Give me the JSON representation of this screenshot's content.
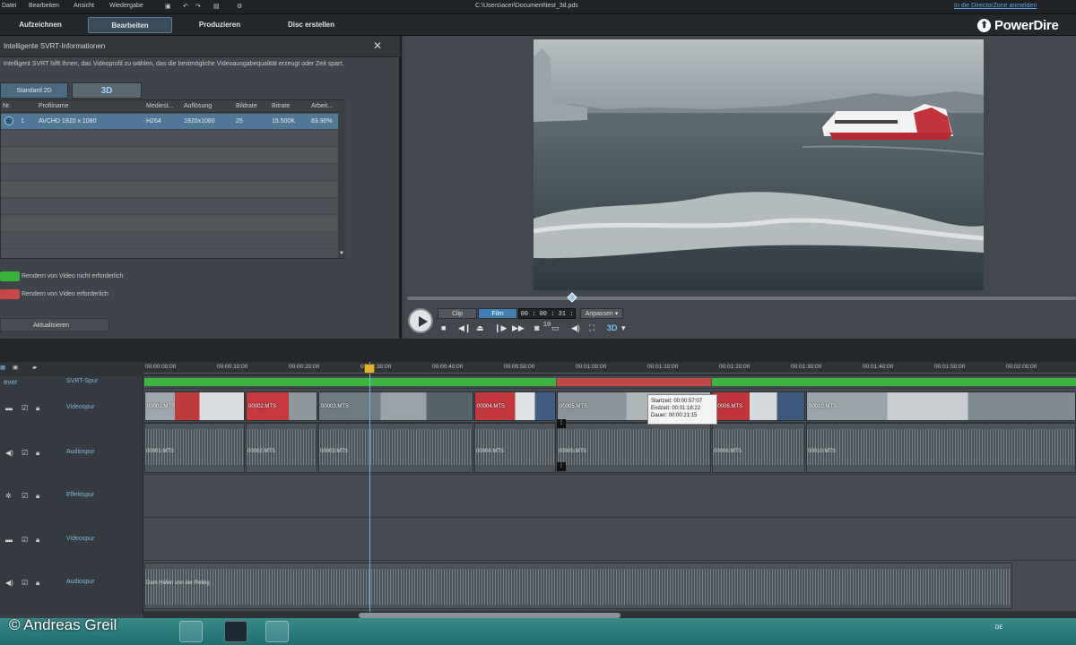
{
  "menu": {
    "items": [
      "Datei",
      "Bearbeiten",
      "Ansicht",
      "Wiedergabe"
    ],
    "file_path": "C:\\Users\\acer\\Document\\test_3d.pds",
    "login_link": "In die DirectorZone anmelden"
  },
  "tabs": {
    "capture": "Aufzeichnen",
    "edit": "Bearbeiten",
    "produce": "Produzieren",
    "disc": "Disc erstellen"
  },
  "app": {
    "logo": "PowerDire"
  },
  "svrt_panel": {
    "title": "Intelligente SVRT-Informationen",
    "description": "Intelligent SVRT hilft Ihnen, das Videoprofil zu wählen, das die bestmögliche Videoausgabequalität erzeugt oder Zeit spart.",
    "subtabs": [
      "Standard 2D",
      "3D"
    ],
    "columns": [
      "Nr.",
      "Profilname",
      "Mediest...",
      "Auflösung",
      "Bildrate",
      "Bitrate",
      "Arbeit..."
    ],
    "rows": [
      {
        "nr": "1",
        "profile": "AVCHD 1920 x 1080",
        "media": "H264",
        "resolution": "1920x1080",
        "framerate": "25",
        "bitrate": "15.500K",
        "work": "83.90%"
      }
    ],
    "legend": [
      {
        "text": "Rendern von Video nicht erforderlich",
        "color": "#36b23b"
      },
      {
        "text": "Rendern von Video erforderlich",
        "color": "#c84848"
      }
    ],
    "refresh_button": "Aktualisieren"
  },
  "preview": {
    "mode_clip": "Clip",
    "mode_film": "Film",
    "timecode": "00 : 00 : 31 : 10",
    "fit": "Anpassen",
    "three_d": "3D"
  },
  "timeline": {
    "ruler": [
      "00:00:00:00",
      "00:00:10:00",
      "00:00:20:00",
      "00:00:30:00",
      "00:00:40:00",
      "00:00:50:00",
      "00:01:00:00",
      "00:01:10:00",
      "00:01:20:00",
      "00:01:30:00",
      "00:01:40:00",
      "00:01:50:00",
      "00:02:00:00"
    ],
    "tracks": [
      {
        "name": "SVRT-Spur",
        "label_left": "ever"
      },
      {
        "name": "Videospur"
      },
      {
        "name": "Audiospur"
      },
      {
        "name": "Effektspur"
      },
      {
        "name": "Videospur"
      },
      {
        "name": "Audiospur"
      }
    ],
    "video_clips": [
      "00001.MTS",
      "00002.MTS",
      "00003.MTS",
      "00004.MTS",
      "00005.MTS",
      "00006.MTS",
      "00010.MTS"
    ],
    "audio_clips": [
      "00001.MTS",
      "00002.MTS",
      "00003.MTS",
      "00004.MTS",
      "00005.MTS",
      "00006.MTS",
      "00010.MTS"
    ],
    "music_clip": "Dam Hafen von der Reling",
    "tooltip": {
      "start": "Startzeit: 00:00:57:07",
      "end": "Endzeit: 00:01:18:22",
      "duration": "Dauer: 00:00:21:15"
    }
  },
  "taskbar": {
    "copyright": "© Andreas Greil",
    "tray": "DE"
  }
}
